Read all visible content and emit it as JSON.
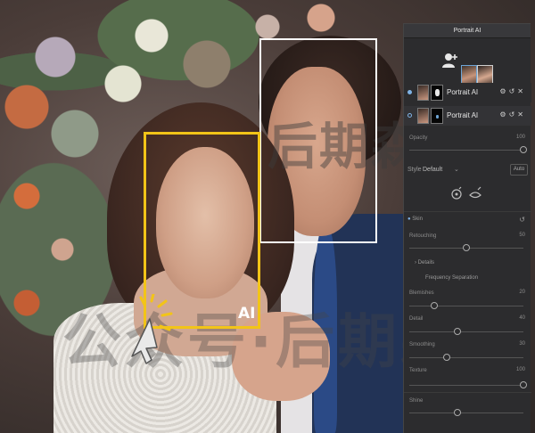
{
  "overlay": {
    "ai_badge": "AI",
    "watermark_top": "后期森",
    "watermark_bottom": "公众号·后期森"
  },
  "panel": {
    "title": "Portrait AI",
    "layers": [
      {
        "label": "Portrait AI",
        "selected": true
      },
      {
        "label": "Portrait AI",
        "selected": false
      }
    ],
    "opacity": {
      "label": "Opacity",
      "value": "100"
    },
    "style": {
      "label": "Style",
      "value": "Default",
      "auto_label": "Auto"
    },
    "skin": {
      "label": "Skin"
    },
    "retouching": {
      "label": "Retouching",
      "value": "50"
    },
    "details": {
      "label": "Details"
    },
    "frequency_separation": {
      "label": "Frequency Separation"
    },
    "blemishes": {
      "label": "Blemishes",
      "value": "20"
    },
    "detail": {
      "label": "Detail",
      "value": "40"
    },
    "smoothing": {
      "label": "Smoothing",
      "value": "30"
    },
    "texture": {
      "label": "Texture",
      "value": "100"
    },
    "shine": {
      "label": "Shine"
    }
  },
  "colors": {
    "accent_blue": "#7fb2e5",
    "face_box_yellow": "#f2c418",
    "panel_bg": "#2c2c2e"
  }
}
